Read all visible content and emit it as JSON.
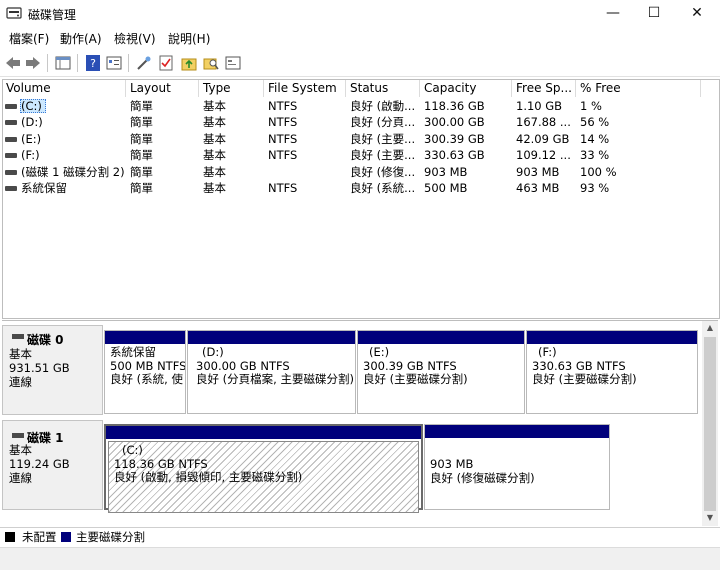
{
  "window": {
    "title": "磁碟管理",
    "minimize": "—",
    "maximize": "☐",
    "close": "✕"
  },
  "menu": [
    "檔案(F)",
    "動作(A)",
    "檢視(V)",
    "說明(H)"
  ],
  "toolbar": {
    "icons": [
      "back-arrow-icon",
      "forward-arrow-icon",
      "properties-grid-icon",
      "help-icon",
      "list-view-icon",
      "wand-icon",
      "check-icon",
      "folder-up-icon",
      "search-folder-icon",
      "window-icon"
    ]
  },
  "volume_table": {
    "columns": [
      "Volume",
      "Layout",
      "Type",
      "File System",
      "Status",
      "Capacity",
      "Free Sp...",
      "% Free"
    ],
    "rows": [
      [
        "(C:)",
        "簡單",
        "基本",
        "NTFS",
        "良好 (啟動...",
        "118.36 GB",
        "1.10 GB",
        "1 %"
      ],
      [
        "(D:)",
        "簡單",
        "基本",
        "NTFS",
        "良好 (分頁...",
        "300.00 GB",
        "167.88 ...",
        "56 %"
      ],
      [
        "(E:)",
        "簡單",
        "基本",
        "NTFS",
        "良好 (主要...",
        "300.39 GB",
        "42.09 GB",
        "14 %"
      ],
      [
        "(F:)",
        "簡單",
        "基本",
        "NTFS",
        "良好 (主要...",
        "330.63 GB",
        "109.12 ...",
        "33 %"
      ],
      [
        "(磁碟 1 磁碟分割 2)",
        "簡單",
        "基本",
        "",
        "良好 (修復...",
        "903 MB",
        "903 MB",
        "100 %"
      ],
      [
        "系統保留",
        "簡單",
        "基本",
        "NTFS",
        "良好 (系統...",
        "500 MB",
        "463 MB",
        "93 %"
      ]
    ]
  },
  "disks": [
    {
      "name": "磁碟 0",
      "type": "基本",
      "size": "931.51 GB",
      "state": "連線",
      "partitions": [
        {
          "label": "系統保留",
          "size": "500 MB NTFS",
          "status": "良好 (系統, 使"
        },
        {
          "label": "(D:)",
          "size": "300.00 GB NTFS",
          "status": "良好 (分頁檔案, 主要磁碟分割)"
        },
        {
          "label": "(E:)",
          "size": "300.39 GB NTFS",
          "status": "良好 (主要磁碟分割)"
        },
        {
          "label": "(F:)",
          "size": "330.63 GB NTFS",
          "status": "良好 (主要磁碟分割)"
        }
      ]
    },
    {
      "name": "磁碟 1",
      "type": "基本",
      "size": "119.24 GB",
      "state": "連線",
      "partitions": [
        {
          "label": "(C:)",
          "size": "118.36 GB NTFS",
          "status": "良好 (啟動, 損毀傾印, 主要磁碟分割)"
        },
        {
          "label": "",
          "size": "903 MB",
          "status": "良好 (修復磁碟分割)"
        }
      ]
    }
  ],
  "legend": [
    {
      "label": "未配置",
      "color": "#000000"
    },
    {
      "label": "主要磁碟分割",
      "color": "#00007b"
    }
  ],
  "colors": {
    "partition_bar": "#00007b",
    "selected_bg": "#cce8ff"
  }
}
